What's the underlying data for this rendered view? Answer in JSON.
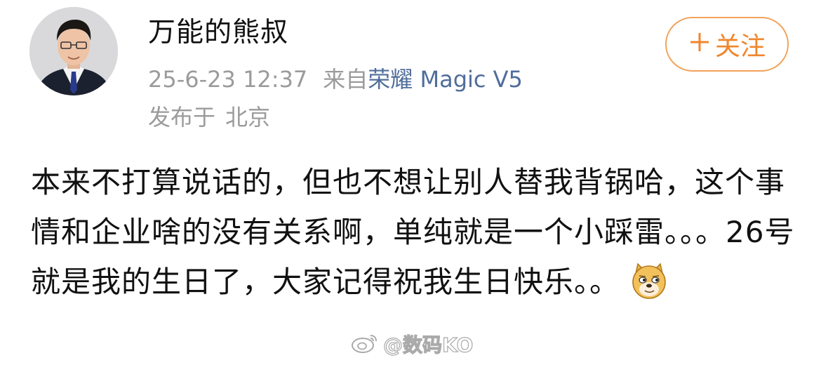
{
  "post": {
    "author": "万能的熊叔",
    "time": "25-6-23 12:37",
    "source_prefix": "来自",
    "source_device": "荣耀 Magic V5",
    "location_prefix": "发布于",
    "location": "北京",
    "follow_label": "关注",
    "body": "本来不打算说话的，但也不想让别人替我背锅哈，这个事情和企业啥的没有关系啊，单纯就是一个小踩雷。。。26号就是我的生日了，大家记得祝我生日快乐。。"
  },
  "watermark": {
    "text": "@数码KO"
  },
  "colors": {
    "follow_orange": "#f0862c",
    "link_blue": "#506d9b",
    "meta_gray": "#9b9b9b"
  },
  "icons": {
    "follow_plus": "plus-icon",
    "emoji": "doge-emoji-icon",
    "watermark_logo": "weibo-logo-icon"
  }
}
